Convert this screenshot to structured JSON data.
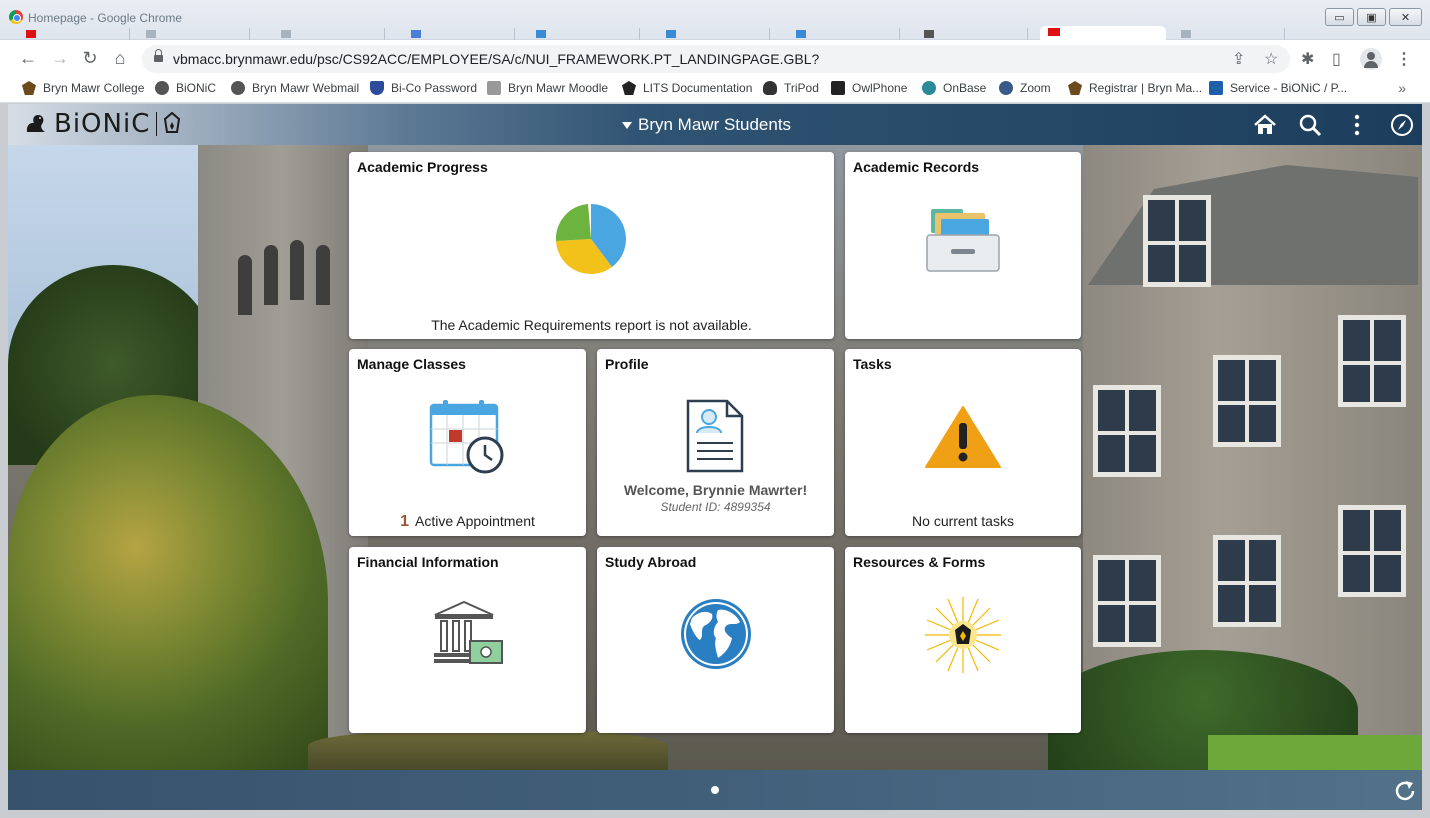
{
  "window": {
    "title": "Homepage - Google Chrome",
    "minimize": "▭",
    "maximize": "▣",
    "close": "✕"
  },
  "browser": {
    "url": "vbmacc.brynmawr.edu/psc/CS92ACC/EMPLOYEE/SA/c/NUI_FRAMEWORK.PT_LANDINGPAGE.GBL?",
    "back": "←",
    "forward": "→",
    "reload": "↻",
    "home": "⌂",
    "share": "⇪",
    "star": "☆",
    "extensions": "✱",
    "sidepanel": "▯",
    "menu": "⋮",
    "more_bookmarks": "»"
  },
  "bookmarks": [
    {
      "label": "Bryn Mawr College",
      "icon": "lantern-icon",
      "color": "#6b4b1e"
    },
    {
      "label": "BiONiC",
      "icon": "globe-icon",
      "color": "#555"
    },
    {
      "label": "Bryn Mawr Webmail",
      "icon": "globe-icon",
      "color": "#555"
    },
    {
      "label": "Bi-Co Password",
      "icon": "shield-icon",
      "color": "#2b4c9a"
    },
    {
      "label": "Bryn Mawr Moodle",
      "icon": "moodle-icon",
      "color": "#888"
    },
    {
      "label": "LITS Documentation",
      "icon": "lantern-icon",
      "color": "#222"
    },
    {
      "label": "TriPod",
      "icon": "owl-icon",
      "color": "#333"
    },
    {
      "label": "OwlPhone",
      "icon": "phone-icon",
      "color": "#222"
    },
    {
      "label": "OnBase",
      "icon": "globe-icon",
      "color": "#2a8a9a"
    },
    {
      "label": "Zoom",
      "icon": "wordpress-icon",
      "color": "#3a5a8a"
    },
    {
      "label": "Registrar | Bryn Ma...",
      "icon": "lantern-icon",
      "color": "#6b4b1e"
    },
    {
      "label": "Service - BiONiC / P...",
      "icon": "td-icon",
      "color": "#1d5fa8"
    }
  ],
  "app": {
    "logo_text": "BiONiC",
    "header_title": "Bryn Mawr Students",
    "home_icon": "home-icon",
    "search_icon": "search-icon",
    "actions_icon": "actions-menu-icon",
    "navbar_icon": "compass-icon"
  },
  "tiles": {
    "academic_progress": {
      "title": "Academic Progress",
      "footer": "The Academic Requirements report is not available."
    },
    "academic_records": {
      "title": "Academic Records"
    },
    "manage_classes": {
      "title": "Manage Classes",
      "count": "1",
      "footer": "Active Appointment"
    },
    "profile": {
      "title": "Profile",
      "welcome": "Welcome, Brynnie Mawrter!",
      "student_id": "Student ID: 4899354"
    },
    "tasks": {
      "title": "Tasks",
      "footer": "No current tasks"
    },
    "financial_information": {
      "title": "Financial Information"
    },
    "study_abroad": {
      "title": "Study Abroad"
    },
    "resources_forms": {
      "title": "Resources & Forms"
    }
  },
  "colors": {
    "accent_orange": "#f0a014",
    "pie_blue": "#4aa6e0",
    "pie_yellow": "#f2c21b",
    "pie_green": "#6cb33f",
    "count_color": "#a0522d"
  }
}
